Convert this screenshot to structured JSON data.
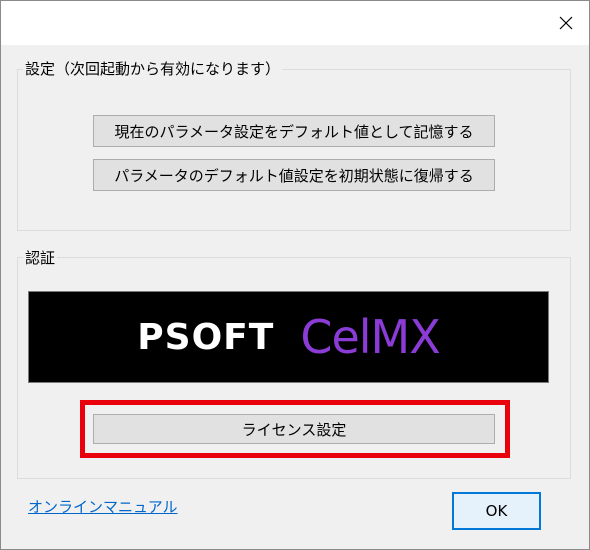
{
  "window": {
    "close_icon": "close-icon"
  },
  "settings_group": {
    "legend": "設定（次回起動から有効になります）",
    "save_defaults_label": "現在のパラメータ設定をデフォルト値として記憶する",
    "reset_defaults_label": "パラメータのデフォルト値設定を初期状態に復帰する"
  },
  "auth_group": {
    "legend": "認証",
    "banner": {
      "brand": "PSOFT",
      "product": "CelMX",
      "product_color": "#8b3bd6"
    },
    "license_label": "ライセンス設定",
    "highlight_color": "#e8000b"
  },
  "footer": {
    "manual_link": "オンラインマニュアル",
    "ok_label": "OK"
  }
}
